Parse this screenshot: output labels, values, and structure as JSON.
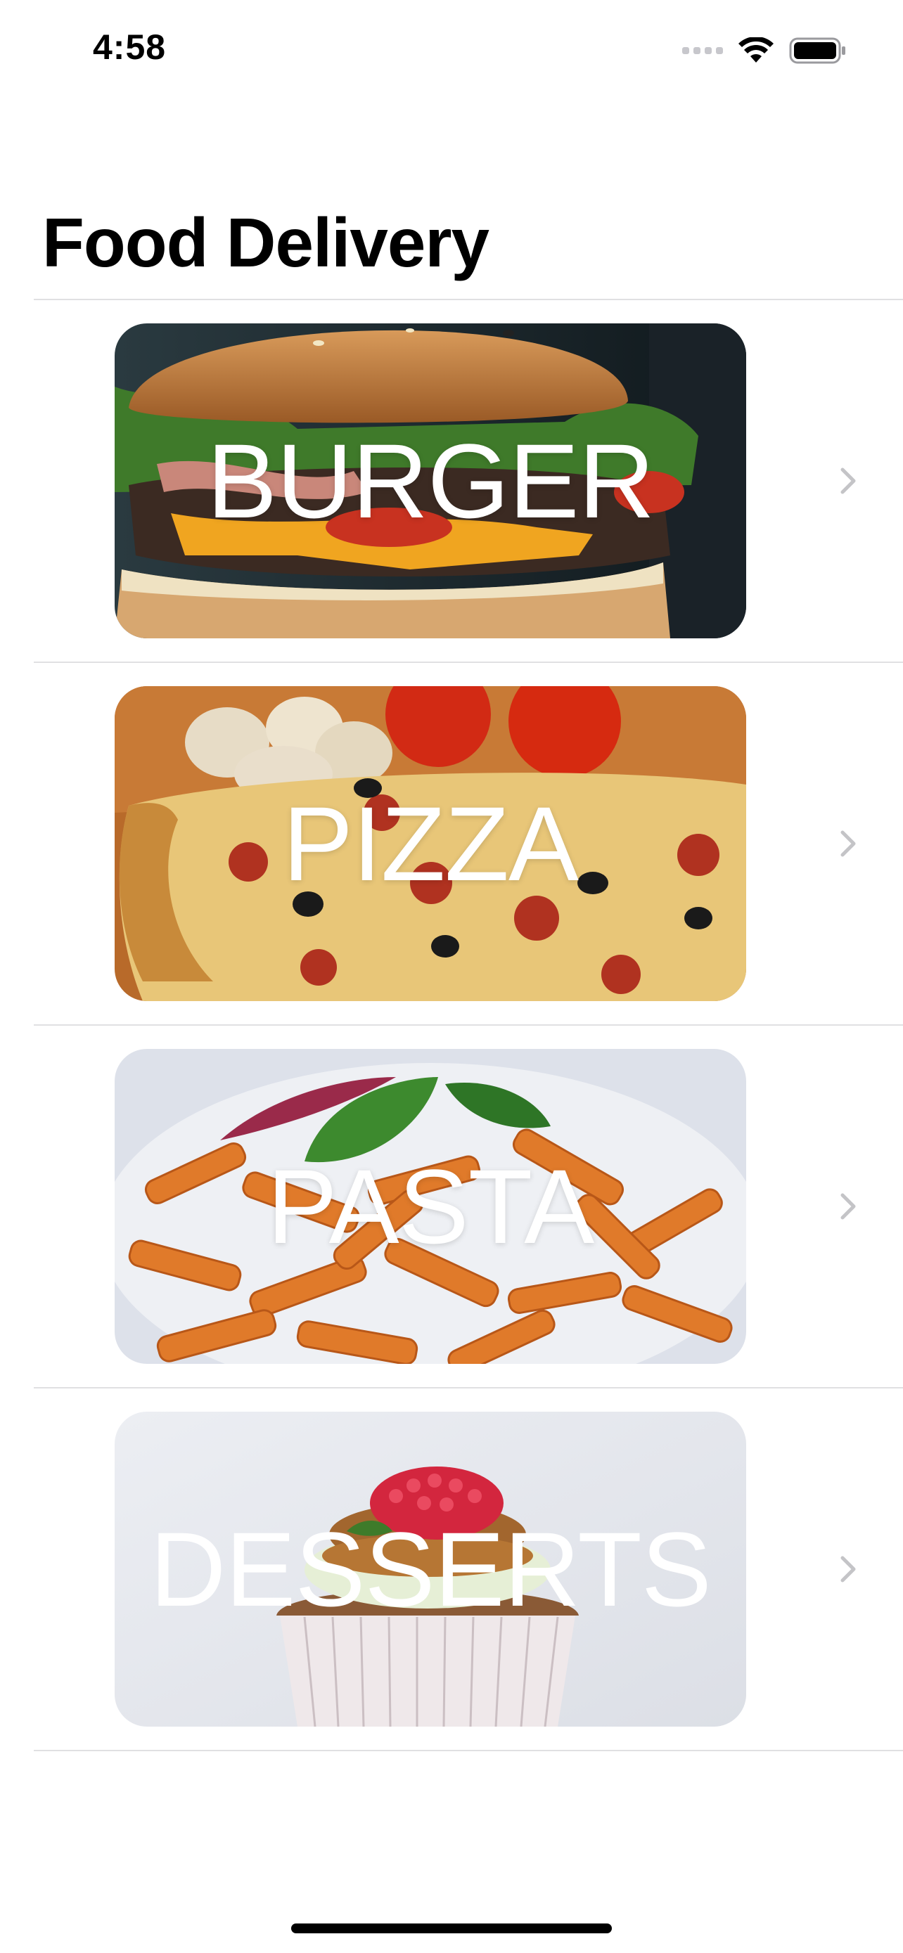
{
  "status_bar": {
    "time": "4:58",
    "icons": [
      "cellular-signal-icon",
      "wifi-icon",
      "battery-icon"
    ]
  },
  "header": {
    "title": "Food Delivery"
  },
  "categories": [
    {
      "label": "BURGER",
      "image": "burger-image",
      "chevron": "chevron-right-icon"
    },
    {
      "label": "PIZZA",
      "image": "pizza-image",
      "chevron": "chevron-right-icon"
    },
    {
      "label": "PASTA",
      "image": "pasta-image",
      "chevron": "chevron-right-icon"
    },
    {
      "label": "DESSERTS",
      "image": "cupcake-image",
      "chevron": "chevron-right-icon"
    }
  ],
  "colors": {
    "divider": "#e0e0e2",
    "chevron": "#c4c4c7",
    "label_text": "#ffffff"
  }
}
